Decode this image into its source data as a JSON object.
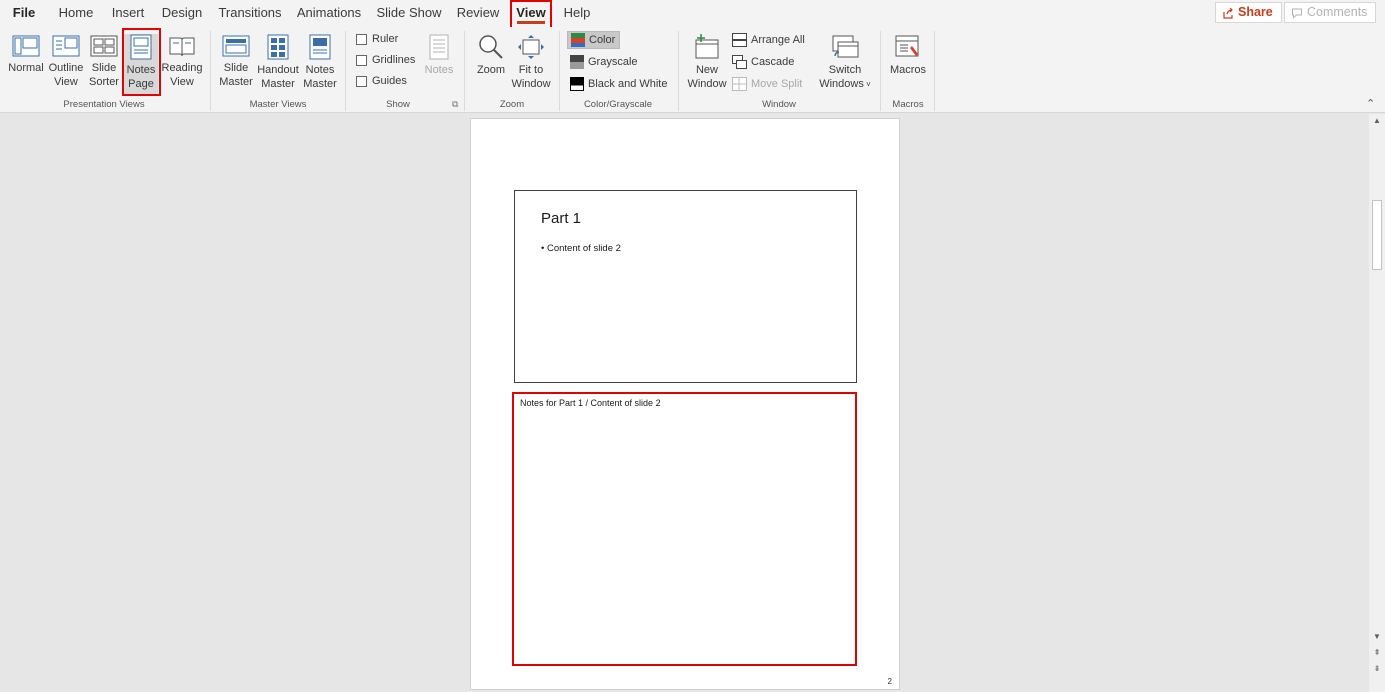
{
  "tabs": {
    "file": "File",
    "home": "Home",
    "insert": "Insert",
    "design": "Design",
    "transitions": "Transitions",
    "animations": "Animations",
    "slide_show": "Slide Show",
    "review": "Review",
    "view": "View",
    "help": "Help",
    "active": "View"
  },
  "top_actions": {
    "share": "Share",
    "comments": "Comments"
  },
  "ribbon": {
    "presentation_views": {
      "label": "Presentation Views",
      "normal": "Normal",
      "outline_1": "Outline",
      "outline_2": "View",
      "sorter_1": "Slide",
      "sorter_2": "Sorter",
      "notes_1": "Notes",
      "notes_2": "Page",
      "reading_1": "Reading",
      "reading_2": "View",
      "selected": "Notes Page"
    },
    "master_views": {
      "label": "Master Views",
      "slide_1": "Slide",
      "slide_2": "Master",
      "handout_1": "Handout",
      "handout_2": "Master",
      "notes_1": "Notes",
      "notes_2": "Master"
    },
    "show": {
      "label": "Show",
      "ruler": "Ruler",
      "gridlines": "Gridlines",
      "guides": "Guides",
      "ruler_checked": false,
      "gridlines_checked": false,
      "guides_checked": false,
      "notes": "Notes"
    },
    "zoom": {
      "label": "Zoom",
      "zoom": "Zoom",
      "fit_1": "Fit to",
      "fit_2": "Window"
    },
    "color": {
      "label": "Color/Grayscale",
      "color": "Color",
      "grayscale": "Grayscale",
      "bw": "Black and White",
      "selected": "Color"
    },
    "window": {
      "label": "Window",
      "new_1": "New",
      "new_2": "Window",
      "arrange": "Arrange All",
      "cascade": "Cascade",
      "move_split": "Move Split",
      "switch_1": "Switch",
      "switch_2": "Windows"
    },
    "macros": {
      "label": "Macros",
      "macros": "Macros"
    }
  },
  "page": {
    "slide_title": "Part 1",
    "slide_bullet": "• Content of slide 2",
    "notes": "Notes for Part 1 / Content of slide 2",
    "page_number": "2"
  },
  "colors": {
    "accent": "#c43e1c",
    "highlight": "#e00000",
    "ribbon_bg": "#f3f3f3",
    "canvas_bg": "#e6e6e6"
  }
}
